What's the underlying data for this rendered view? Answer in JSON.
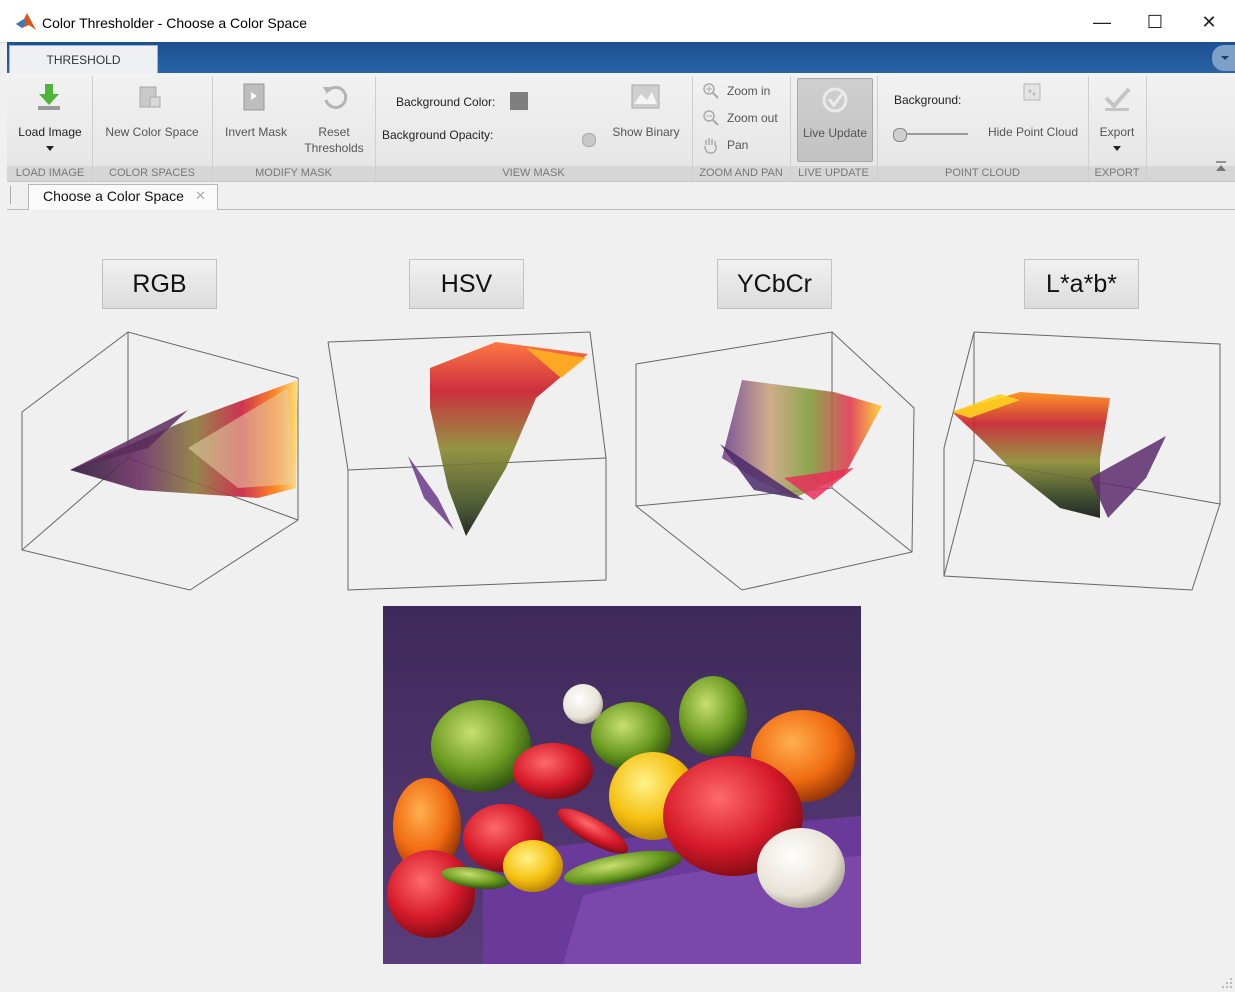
{
  "window": {
    "title": "Color Thresholder - Choose a Color Space",
    "minimize": "—",
    "maximize": "☐",
    "close": "✕"
  },
  "ribbon": {
    "tab": "THRESHOLD",
    "buttons": {
      "load_image": "Load Image",
      "new_color_space": "New Color Space",
      "invert_mask": "Invert Mask",
      "reset_thresholds_line1": "Reset",
      "reset_thresholds_line2": "Thresholds",
      "show_binary": "Show Binary",
      "zoom_in": "Zoom in",
      "zoom_out": "Zoom out",
      "pan": "Pan",
      "live_update": "Live Update",
      "hide_point_cloud": "Hide Point Cloud",
      "export": "Export"
    },
    "background_color_label": "Background Color:",
    "background_opacity_label": "Background Opacity:",
    "point_cloud_background_label": "Background:",
    "background_opacity": 0,
    "point_cloud_background_level": 0,
    "sections": {
      "load_image": "LOAD IMAGE",
      "color_spaces": "COLOR SPACES",
      "modify_mask": "MODIFY MASK",
      "view_mask": "VIEW MASK",
      "zoom_and_pan": "ZOOM AND PAN",
      "live_update": "LIVE UPDATE",
      "point_cloud": "POINT CLOUD",
      "export": "EXPORT"
    },
    "colors": {
      "accent_blue": "#2a63a8",
      "bg_swatch": "#7f7f7f"
    }
  },
  "document_tab": {
    "label": "Choose a Color Space",
    "close": "✕"
  },
  "color_spaces": [
    {
      "label": "RGB"
    },
    {
      "label": "HSV"
    },
    {
      "label": "YCbCr"
    },
    {
      "label": "L*a*b*"
    }
  ]
}
